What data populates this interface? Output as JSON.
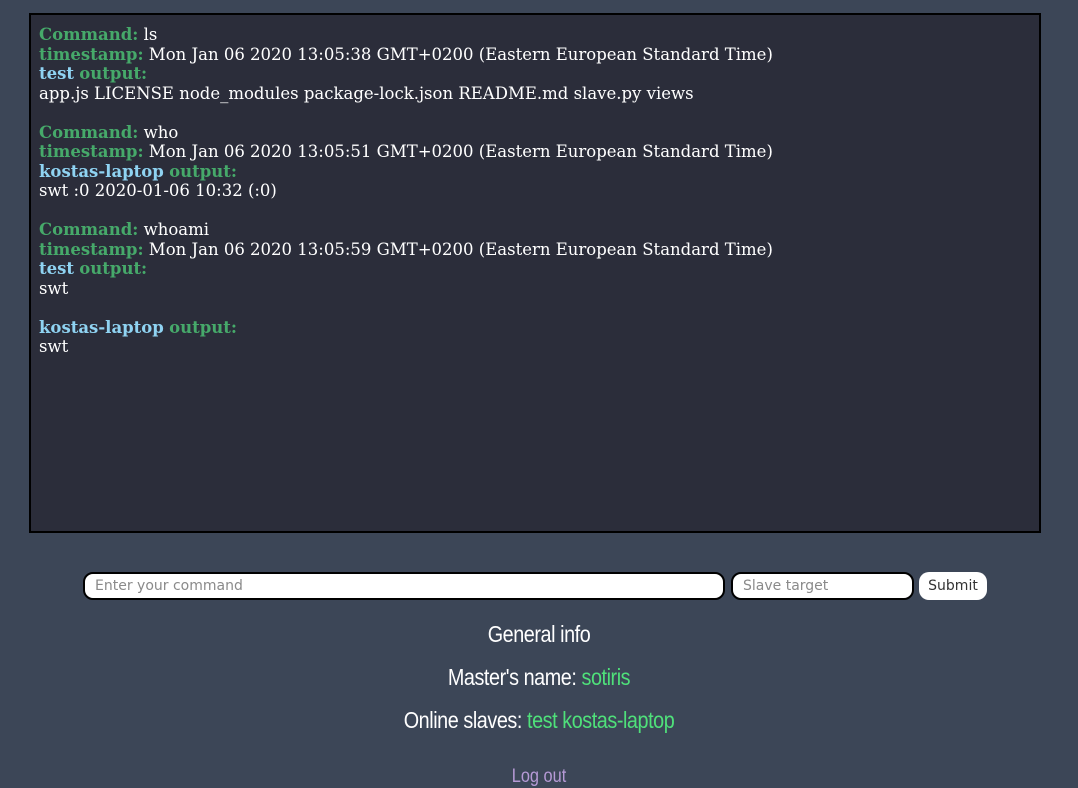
{
  "console": {
    "entries": [
      {
        "command_label": "Command:",
        "command": "ls",
        "timestamp_label": "timestamp:",
        "timestamp": "Mon Jan 06 2020 13:05:38 GMT+0200 (Eastern European Standard Time)",
        "outputs": [
          {
            "host": "test",
            "output_label": "output:",
            "text": "app.js LICENSE node_modules package-lock.json README.md slave.py views"
          }
        ]
      },
      {
        "command_label": "Command:",
        "command": "who",
        "timestamp_label": "timestamp:",
        "timestamp": "Mon Jan 06 2020 13:05:51 GMT+0200 (Eastern European Standard Time)",
        "outputs": [
          {
            "host": "kostas-laptop",
            "output_label": "output:",
            "text": "swt :0 2020-01-06 10:32 (:0)"
          }
        ]
      },
      {
        "command_label": "Command:",
        "command": "whoami",
        "timestamp_label": "timestamp:",
        "timestamp": "Mon Jan 06 2020 13:05:59 GMT+0200 (Eastern European Standard Time)",
        "outputs": [
          {
            "host": "test",
            "output_label": "output:",
            "text": "swt"
          },
          {
            "host": "kostas-laptop",
            "output_label": "output:",
            "text": "swt"
          }
        ]
      }
    ]
  },
  "form": {
    "command_placeholder": "Enter your command",
    "target_placeholder": "Slave target",
    "submit_label": "Submit"
  },
  "info": {
    "title": "General info",
    "master_label": "Master's name:",
    "master_name": "sotiris",
    "slaves_label": "Online slaves:",
    "slaves": "test kostas-laptop"
  },
  "logout_label": "Log out",
  "colors": {
    "background": "#3c4657",
    "console_bg": "#2b2d3a",
    "key": "#46a96a",
    "host": "#8fd3f2",
    "accent": "#4fe07a",
    "logout": "#b69ad6"
  }
}
